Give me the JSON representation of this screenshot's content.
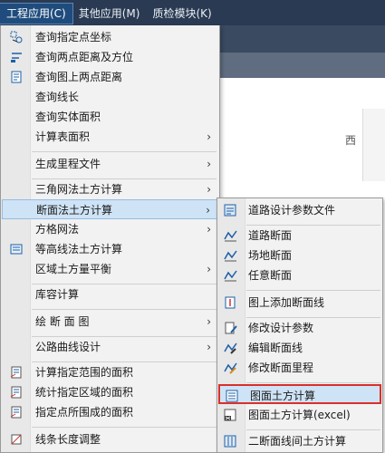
{
  "menubar": {
    "items": [
      {
        "label": "工程应用(C)"
      },
      {
        "label": "其他应用(M)"
      },
      {
        "label": "质检模块(K)"
      }
    ]
  },
  "background": {
    "west_label": "西"
  },
  "main_menu": {
    "items": [
      {
        "label": "查询指定点坐标",
        "icon": "point-coordinate-icon"
      },
      {
        "label": "查询两点距离及方位",
        "icon": "two-point-distance-icon"
      },
      {
        "label": "查询图上两点距离",
        "icon": "map-distance-icon"
      },
      {
        "label": "查询线长"
      },
      {
        "label": "查询实体面积"
      },
      {
        "label": "计算表面积",
        "submenu": true
      },
      {
        "label": "生成里程文件",
        "submenu": true
      },
      {
        "label": "三角网法土方计算",
        "submenu": true
      },
      {
        "label": "断面法土方计算",
        "submenu": true,
        "highlighted": true
      },
      {
        "label": "方格网法",
        "submenu": true
      },
      {
        "label": "等高线法土方计算",
        "icon": "contour-volume-icon"
      },
      {
        "label": "区域土方量平衡",
        "submenu": true
      },
      {
        "label": "库容计算"
      },
      {
        "label": "绘 断 面 图",
        "submenu": true
      },
      {
        "label": "公路曲线设计",
        "submenu": true
      },
      {
        "label": "计算指定范围的面积",
        "icon": "range-area-icon"
      },
      {
        "label": "统计指定区域的面积",
        "icon": "region-area-icon"
      },
      {
        "label": "指定点所围成的面积",
        "icon": "points-area-icon"
      },
      {
        "label": "线条长度调整",
        "icon": "line-length-icon"
      }
    ],
    "arrow": "›"
  },
  "sub_menu": {
    "items": [
      {
        "label": "道路设计参数文件",
        "icon": "road-params-icon"
      },
      {
        "label": "道路断面",
        "icon": "road-section-icon"
      },
      {
        "label": "场地断面",
        "icon": "site-section-icon"
      },
      {
        "label": "任意断面",
        "icon": "any-section-icon"
      },
      {
        "label": "图上添加断面线",
        "icon": "add-section-line-icon"
      },
      {
        "label": "修改设计参数",
        "icon": "edit-params-icon"
      },
      {
        "label": "编辑断面线",
        "icon": "edit-section-line-icon"
      },
      {
        "label": "修改断面里程",
        "icon": "edit-mileage-icon"
      },
      {
        "label": "图面土方计算",
        "icon": "map-volume-icon",
        "selected": true
      },
      {
        "label": "图面土方计算(excel)",
        "icon": "excel-volume-icon"
      },
      {
        "label": "二断面线间土方计算",
        "icon": "two-section-volume-icon"
      }
    ]
  }
}
